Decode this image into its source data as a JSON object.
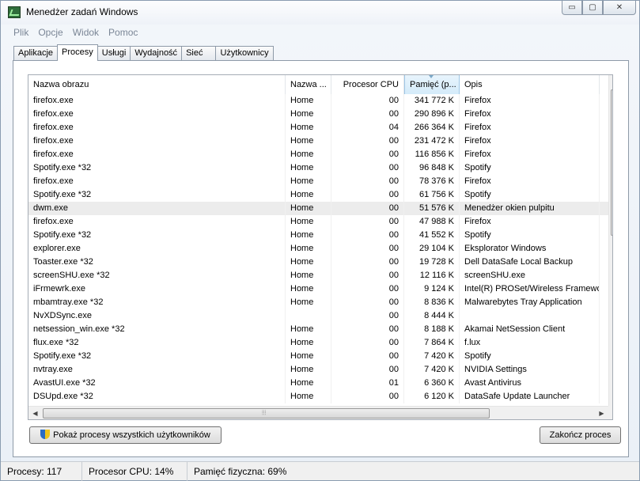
{
  "window": {
    "title": "Menedżer zadań Windows",
    "minimize": "▭",
    "maximize": "▢",
    "close": "✕"
  },
  "menu": [
    "Plik",
    "Opcje",
    "Widok",
    "Pomoc"
  ],
  "tabs": [
    "Aplikacje",
    "Procesy",
    "Usługi",
    "Wydajność",
    "Sieć",
    "Użytkownicy"
  ],
  "active_tab": "Procesy",
  "columns": [
    "Nazwa obrazu",
    "Nazwa ...",
    "Procesor CPU",
    "Pamięć (p...",
    "Opis"
  ],
  "processes": [
    [
      "firefox.exe",
      "Home",
      "00",
      "341 772 K",
      "Firefox"
    ],
    [
      "firefox.exe",
      "Home",
      "00",
      "290 896 K",
      "Firefox"
    ],
    [
      "firefox.exe",
      "Home",
      "04",
      "266 364 K",
      "Firefox"
    ],
    [
      "firefox.exe",
      "Home",
      "00",
      "231 472 K",
      "Firefox"
    ],
    [
      "firefox.exe",
      "Home",
      "00",
      "116 856 K",
      "Firefox"
    ],
    [
      "Spotify.exe *32",
      "Home",
      "00",
      "96 848 K",
      "Spotify"
    ],
    [
      "firefox.exe",
      "Home",
      "00",
      "78 376 K",
      "Firefox"
    ],
    [
      "Spotify.exe *32",
      "Home",
      "00",
      "61 756 K",
      "Spotify"
    ],
    [
      "dwm.exe",
      "Home",
      "00",
      "51 576 K",
      "Menedżer okien pulpitu"
    ],
    [
      "firefox.exe",
      "Home",
      "00",
      "47 988 K",
      "Firefox"
    ],
    [
      "Spotify.exe *32",
      "Home",
      "00",
      "41 552 K",
      "Spotify"
    ],
    [
      "explorer.exe",
      "Home",
      "00",
      "29 104 K",
      "Eksplorator Windows"
    ],
    [
      "Toaster.exe *32",
      "Home",
      "00",
      "19 728 K",
      "Dell DataSafe Local Backup"
    ],
    [
      "screenSHU.exe *32",
      "Home",
      "00",
      "12 116 K",
      "screenSHU.exe"
    ],
    [
      "iFrmewrk.exe",
      "Home",
      "00",
      "9 124 K",
      "Intel(R) PROSet/Wireless Framework"
    ],
    [
      "mbamtray.exe *32",
      "Home",
      "00",
      "8 836 K",
      "Malwarebytes Tray Application"
    ],
    [
      "NvXDSync.exe",
      "",
      "00",
      "8 444 K",
      ""
    ],
    [
      "netsession_win.exe *32",
      "Home",
      "00",
      "8 188 K",
      "Akamai NetSession Client"
    ],
    [
      "flux.exe *32",
      "Home",
      "00",
      "7 864 K",
      "f.lux"
    ],
    [
      "Spotify.exe *32",
      "Home",
      "00",
      "7 420 K",
      "Spotify"
    ],
    [
      "nvtray.exe",
      "Home",
      "00",
      "7 420 K",
      "NVIDIA Settings"
    ],
    [
      "AvastUI.exe *32",
      "Home",
      "01",
      "6 360 K",
      "Avast Antivirus"
    ],
    [
      "DSUpd.exe *32",
      "Home",
      "00",
      "6 120 K",
      "DataSafe Update Launcher"
    ]
  ],
  "selected_row": 8,
  "buttons": {
    "show_all": "Pokaż procesy wszystkich użytkowników",
    "end_process": "Zakończ proces"
  },
  "status": {
    "processes": "Procesy: 117",
    "cpu": "Procesor CPU: 14%",
    "memory": "Pamięć fizyczna: 69%"
  }
}
